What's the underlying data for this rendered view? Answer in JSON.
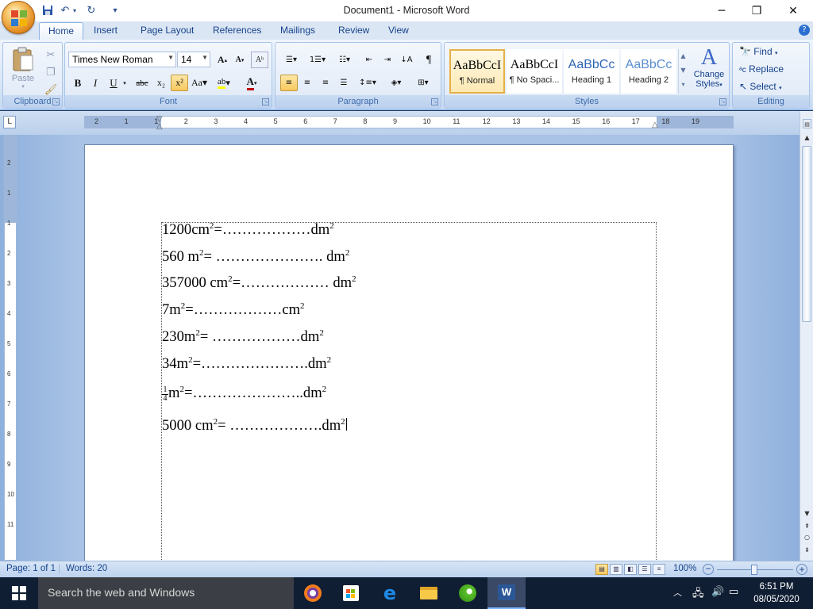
{
  "window": {
    "title": "Document1 - Microsoft Word",
    "controls": {
      "minimize": "─",
      "maximize": "❐",
      "close": "✕"
    }
  },
  "ribbon": {
    "tabs": [
      "Home",
      "Insert",
      "Page Layout",
      "References",
      "Mailings",
      "Review",
      "View"
    ],
    "active_tab": "Home",
    "groups": {
      "clipboard": {
        "label": "Clipboard",
        "paste": "Paste"
      },
      "font": {
        "label": "Font",
        "font_name": "Times New Roman",
        "font_size": "14"
      },
      "paragraph": {
        "label": "Paragraph"
      },
      "styles": {
        "label": "Styles",
        "items": [
          {
            "preview": "AaBbCcI",
            "name": "¶ Normal",
            "selected": true
          },
          {
            "preview": "AaBbCcI",
            "name": "¶ No Spaci...",
            "selected": false
          },
          {
            "preview": "AaBbCc",
            "name": "Heading 1",
            "selected": false
          },
          {
            "preview": "AaBbCc",
            "name": "Heading 2",
            "selected": false
          }
        ],
        "change_styles_line1": "Change",
        "change_styles_line2": "Styles"
      },
      "editing": {
        "label": "Editing",
        "find": "Find",
        "replace": "Replace",
        "select": "Select"
      }
    }
  },
  "ruler": {
    "numbers": [
      "2",
      "1",
      "1",
      "2",
      "3",
      "4",
      "5",
      "6",
      "7",
      "8",
      "9",
      "10",
      "11",
      "12",
      "13",
      "14",
      "15",
      "16",
      "17",
      "18",
      "19"
    ],
    "vertical_numbers": [
      "2",
      "1",
      "1",
      "2",
      "3",
      "4",
      "5",
      "6",
      "7",
      "8",
      "9",
      "10",
      "11"
    ]
  },
  "document": {
    "lines": [
      {
        "before": "1200cm",
        "sup1": "2",
        "mid": "=………………dm",
        "sup2": "2"
      },
      {
        "before": "560 m",
        "sup1": "2",
        "mid": "= …………………. dm",
        "sup2": "2"
      },
      {
        "before": "357000 cm",
        "sup1": "2",
        "mid": "=……………… dm",
        "sup2": "2"
      },
      {
        "before": "7m",
        "sup1": "2",
        "mid": "=………………cm",
        "sup2": "2"
      },
      {
        "before": "230m",
        "sup1": "2",
        "mid": "= ………………dm",
        "sup2": "2"
      },
      {
        "before": "34m",
        "sup1": "2",
        "mid": "=………………….dm",
        "sup2": "2"
      },
      {
        "frac_num": "1",
        "frac_den": "4",
        "before": "m",
        "sup1": "2",
        "mid": "=…………………..dm",
        "sup2": "2"
      },
      {
        "before": "5000 cm",
        "sup1": "2",
        "mid": "= ……………….dm",
        "sup2": "2"
      }
    ]
  },
  "status": {
    "page": "Page: 1 of 1",
    "words": "Words: 20",
    "zoom": "100%"
  },
  "taskbar": {
    "search_placeholder": "Search the web and Windows",
    "time": "6:51 PM",
    "date": "08/05/2020"
  },
  "colors": {
    "ribbon_accent": "#15428b",
    "selected_style": "#f8c85c",
    "taskbar": "#101e33"
  }
}
